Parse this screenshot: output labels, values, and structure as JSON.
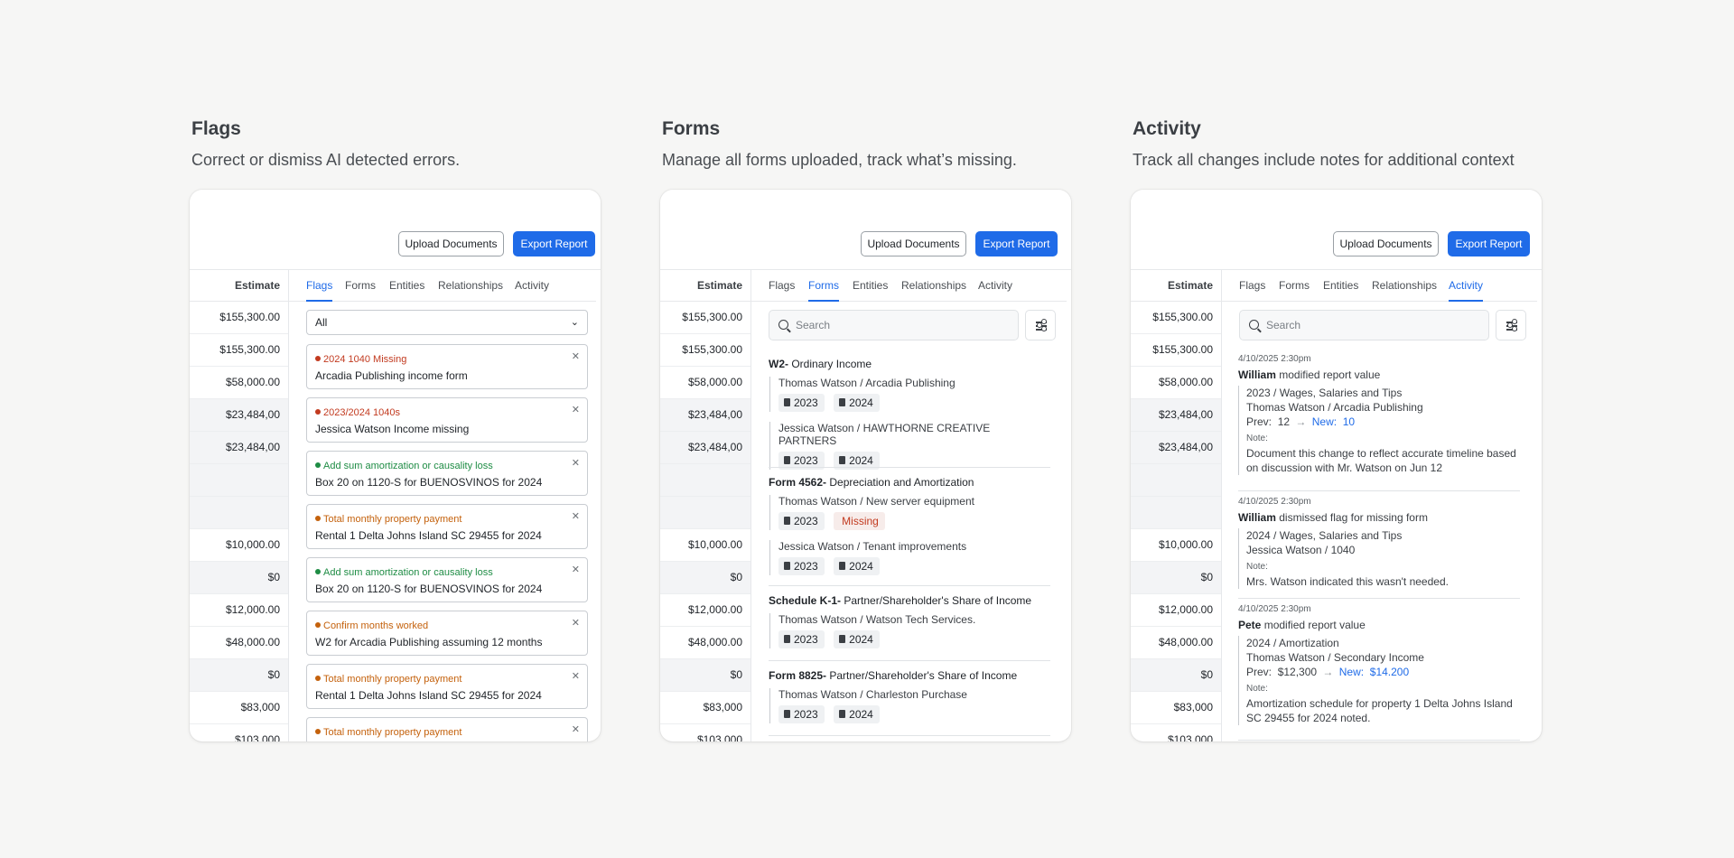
{
  "estimates": [
    "$155,300.00",
    "$155,300.00",
    "$58,000.00",
    "$23,484,00",
    "$23,484,00",
    "",
    "",
    "$10,000.00",
    "$0",
    "$12,000.00",
    "$48,000.00",
    "$0",
    "$83,000",
    "$103,000"
  ],
  "toolbar": {
    "upload_label": "Upload Documents",
    "export_label": "Export Report"
  },
  "estimate_header": "Estimate",
  "tabs": [
    "Flags",
    "Forms",
    "Entities",
    "Relationships",
    "Activity"
  ],
  "sections": [
    {
      "title": "Flags",
      "subtitle": "Correct or dismiss AI detected errors."
    },
    {
      "title": "Forms",
      "subtitle": "Manage all forms uploaded, track what’s missing."
    },
    {
      "title": "Activity",
      "subtitle": "Track all changes include notes for additional context"
    }
  ],
  "flags": {
    "filter_value": "All",
    "items": [
      {
        "title": "2024 1040 Missing",
        "desc": "Arcadia Publishing income form",
        "color": "red"
      },
      {
        "title": "2023/2024 1040s",
        "desc": "Jessica Watson Income missing",
        "color": "red"
      },
      {
        "title": "Add sum amortization or causality loss",
        "desc": "Box 20 on 1120-S for BUENOSVINOS for 2024",
        "color": "green"
      },
      {
        "title": "Total monthly property payment",
        "desc": "Rental 1 Delta Johns Island SC 29455 for 2024",
        "color": "orange"
      },
      {
        "title": "Add sum amortization or causality loss",
        "desc": "Box 20 on 1120-S for BUENOSVINOS for 2024",
        "color": "green"
      },
      {
        "title": "Confirm months worked",
        "desc": "W2 for Arcadia Publishing assuming 12 months",
        "color": "orange"
      },
      {
        "title": "Total monthly property payment",
        "desc": "Rental 1 Delta Johns Island SC 29455 for 2024",
        "color": "orange"
      },
      {
        "title": "Total monthly property payment",
        "desc": "",
        "color": "orange"
      }
    ]
  },
  "search": {
    "placeholder": "Search"
  },
  "forms": [
    {
      "code": "W2-",
      "name": "Ordinary Income",
      "entries": [
        {
          "who": "Thomas Watson / Arcadia Publishing",
          "chips": [
            "2023",
            "2024"
          ]
        },
        {
          "who": "Jessica Watson / HAWTHORNE CREATIVE PARTNERS",
          "chips": [
            "2023",
            "2024"
          ]
        }
      ]
    },
    {
      "code": "Form 4562-",
      "name": "Depreciation and Amortization",
      "entries": [
        {
          "who": "Thomas Watson / New server equipment",
          "chips": [
            "2023"
          ],
          "missing": "Missing"
        },
        {
          "who": "Jessica Watson / Tenant improvements",
          "chips": [
            "2023",
            "2024"
          ]
        }
      ]
    },
    {
      "code": "Schedule K-1-",
      "name": "Partner/Shareholder's Share of Income",
      "entries": [
        {
          "who": "Thomas Watson / Watson Tech Services.",
          "chips": [
            "2023",
            "2024"
          ]
        }
      ]
    },
    {
      "code": "Form 8825-",
      "name": "Partner/Shareholder's Share of Income",
      "entries": [
        {
          "who": "Thomas Watson / Charleston Purchase",
          "chips": [
            "2023",
            "2024"
          ]
        }
      ]
    }
  ],
  "activity": [
    {
      "ts": "4/10/2025 2:30pm",
      "user": "William",
      "action": "modified report value",
      "lines": [
        "2023 / Wages, Salaries and Tips",
        "Thomas Watson / Arcadia Publishing"
      ],
      "prev_label": "Prev:",
      "prev": "12",
      "new_label": "New:",
      "new": "10",
      "note_label": "Note:",
      "note": "Document this change to reflect accurate timeline based on discussion with Mr. Watson on Jun 12"
    },
    {
      "ts": "4/10/2025 2:30pm",
      "user": "William",
      "action": "dismissed flag for missing form",
      "lines": [
        "2024 / Wages, Salaries and Tips",
        "Jessica Watson / 1040"
      ],
      "note_label": "Note:",
      "note": "Mrs. Watson indicated this wasn't needed."
    },
    {
      "ts": "4/10/2025 2:30pm",
      "user": "Pete",
      "action": "modified report value",
      "lines": [
        "2024 / Amortization",
        "Thomas Watson / Secondary Income"
      ],
      "prev_label": "Prev:",
      "prev": "$12,300",
      "new_label": "New:",
      "new": "$14.200",
      "note_label": "Note:",
      "note": "Amortization schedule for property 1 Delta Johns Island SC 29455 for 2024 noted."
    }
  ]
}
